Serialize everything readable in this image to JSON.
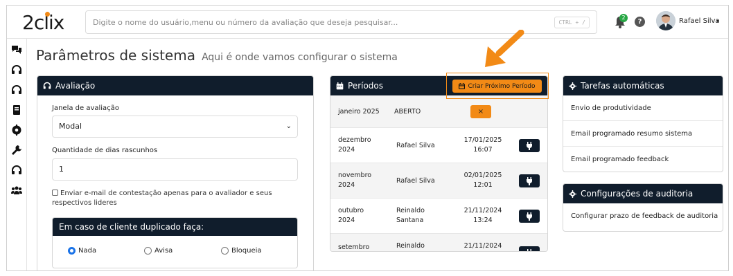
{
  "header": {
    "logo": "2clix",
    "search_placeholder": "Digite o nome do usuário,menu ou número da avaliação que deseja pesquisar...",
    "shortcut": "CTRL + /",
    "notification_count": "2",
    "help": "?",
    "user_name": "Rafael Silva",
    "user_caret": "▾"
  },
  "sidebar": {
    "icons": [
      "chat-icon",
      "headset-icon",
      "headset-icon",
      "book-icon",
      "gear-face-icon",
      "wrench-icon",
      "headset-icon",
      "users-icon"
    ]
  },
  "page": {
    "title": "Parâmetros de sistema",
    "subtitle": "Aqui é onde vamos configurar o sistema"
  },
  "avaliacao": {
    "header": "Avaliação",
    "janela_label": "Janela de avaliação",
    "janela_value": "Modal",
    "dias_label": "Quantidade de dias rascunhos",
    "dias_value": "1",
    "email_check_label": "Enviar e-mail de contestação apenas para o avaliador e seus respectivos lideres",
    "duplicate": {
      "header": "Em caso de cliente duplicado faça:",
      "options": [
        "Nada",
        "Avisa",
        "Bloqueia"
      ],
      "selected": "Nada"
    }
  },
  "periodos": {
    "header": "Períodos",
    "create_button": "Criar Próximo Período",
    "rows": [
      {
        "month": "janeiro 2025",
        "who": "ABERTO",
        "when_date": "",
        "when_time": "",
        "action": "×"
      },
      {
        "month": "dezembro",
        "month_year": "2024",
        "who": "Rafael Silva",
        "when_date": "17/01/2025",
        "when_time": "16:07",
        "action": "plug"
      },
      {
        "month": "novembro",
        "month_year": "2024",
        "who": "Rafael Silva",
        "when_date": "02/01/2025",
        "when_time": "12:01",
        "action": "plug"
      },
      {
        "month": "outubro",
        "month_year": "2024",
        "who": "Reinaldo",
        "who2": "Santana",
        "when_date": "21/11/2024",
        "when_time": "13:24",
        "action": "plug"
      },
      {
        "month": "setembro",
        "month_year": "",
        "who": "Reinaldo",
        "who2": "",
        "when_date": "21/11/2024",
        "when_time": "",
        "action": "plug"
      }
    ]
  },
  "tarefas": {
    "header": "Tarefas automáticas",
    "items": [
      "Envio de produtividade",
      "Email programado resumo sistema",
      "Email programado feedback"
    ]
  },
  "auditoria": {
    "header": "Configurações de auditoria",
    "items": [
      "Configurar prazo de feedback de auditoria"
    ]
  },
  "colors": {
    "navy": "#101d2c",
    "orange": "#f28a16",
    "radio_blue": "#1a73e8",
    "badge_green": "#28a745"
  }
}
